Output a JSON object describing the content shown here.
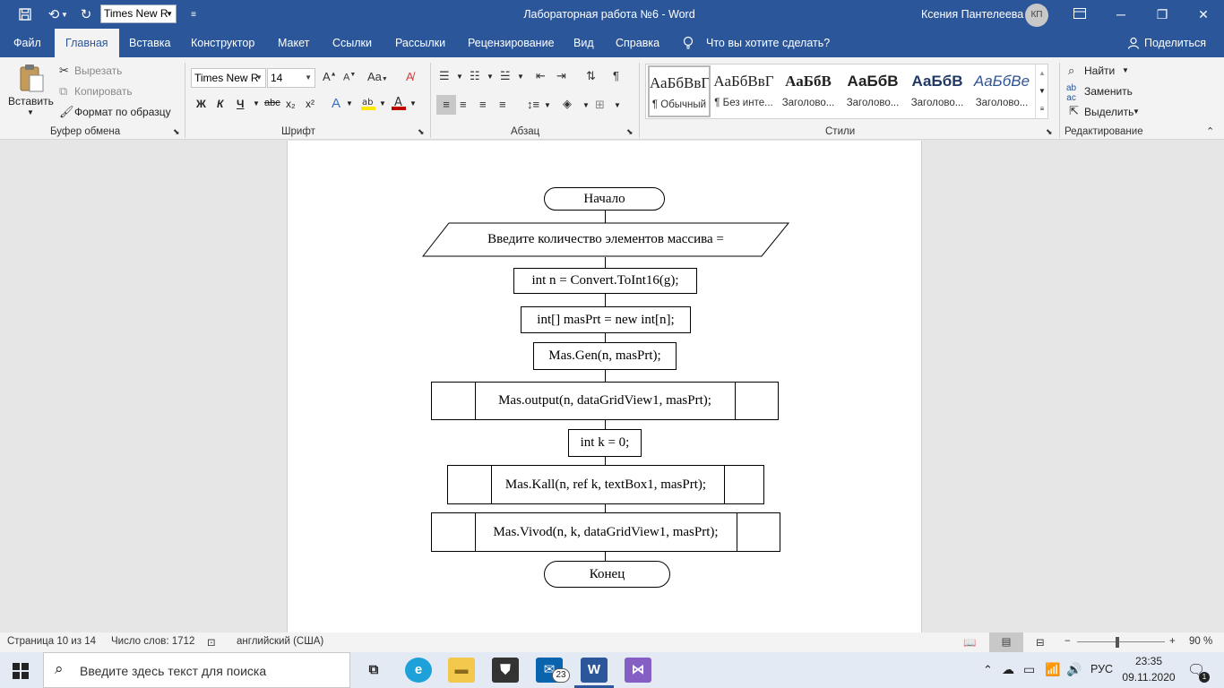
{
  "titlebar": {
    "font_mini": "Times New R",
    "doc_title": "Лабораторная работа №6  -  Word",
    "user": "Ксения Пантелеева",
    "initials": "КП"
  },
  "menu": {
    "file": "Файл",
    "home": "Главная",
    "insert": "Вставка",
    "design": "Конструктор",
    "layout": "Макет",
    "references": "Ссылки",
    "mailings": "Рассылки",
    "review": "Рецензирование",
    "view": "Вид",
    "help": "Справка",
    "tell_me": "Что вы хотите сделать?",
    "share": "Поделиться"
  },
  "ribbon": {
    "clipboard": {
      "paste": "Вставить",
      "cut": "Вырезать",
      "copy": "Копировать",
      "format_painter": "Формат по образцу",
      "label": "Буфер обмена"
    },
    "font": {
      "name": "Times New R",
      "size": "14",
      "label": "Шрифт",
      "bold": "Ж",
      "italic": "К",
      "underline": "Ч",
      "strike": "abc",
      "sub": "x₂",
      "sup": "x²"
    },
    "paragraph": {
      "label": "Абзац"
    },
    "styles": {
      "label": "Стили",
      "items": [
        {
          "sample": "АаБбВвГ",
          "name": "¶ Обычный"
        },
        {
          "sample": "АаБбВвГ",
          "name": "¶ Без инте..."
        },
        {
          "sample": "АаБбВ",
          "name": "Заголово..."
        },
        {
          "sample": "АаБбВ",
          "name": "Заголово..."
        },
        {
          "sample": "АаБбВ",
          "name": "Заголово..."
        },
        {
          "sample": "АаБбВе",
          "name": "Заголово..."
        }
      ]
    },
    "editing": {
      "label": "Редактирование",
      "find": "Найти",
      "replace": "Заменить",
      "select": "Выделить"
    }
  },
  "flowchart": {
    "start": "Начало",
    "input": "Введите количество элементов массива =",
    "step1": "int n = Convert.ToInt16(g);",
    "step2": "int[] masPrt = new int[n];",
    "step3": "Mas.Gen(n, masPrt);",
    "step4": "Mas.output(n, dataGridView1, masPrt);",
    "step5": "int k = 0;",
    "step6": "Mas.Kall(n, ref k, textBox1, masPrt);",
    "step7": "Mas.Vivod(n, k, dataGridView1, masPrt);",
    "end": "Конец"
  },
  "statusbar": {
    "page": "Страница 10 из 14",
    "words": "Число слов: 1712",
    "language": "английский (США)",
    "zoom": "90 %"
  },
  "taskbar": {
    "search_placeholder": "Введите здесь текст для поиска",
    "mail_badge": "23",
    "language": "РУС",
    "time": "23:35",
    "date": "09.11.2020",
    "notif_count": "1"
  }
}
